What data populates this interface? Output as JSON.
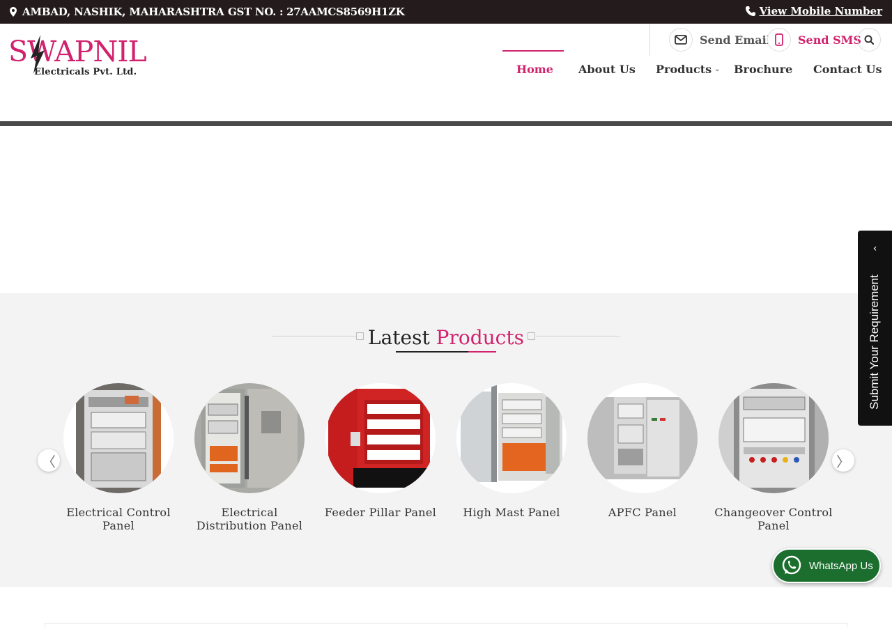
{
  "topbar": {
    "location": "AMBAD, NASHIK, MAHARASHTRA",
    "gst": "GST NO. : 27AAMCS8569H1ZK",
    "mobile_link": "View Mobile Number"
  },
  "logo": {
    "brand": "SWAPNIL",
    "subtitle": "Electricals Pvt. Ltd."
  },
  "header_actions": {
    "send_email": "Send Email",
    "send_sms": "Send SMS"
  },
  "nav": {
    "items": [
      {
        "label": "Home",
        "active": true
      },
      {
        "label": "About Us"
      },
      {
        "label": "Products",
        "has_dropdown": true
      },
      {
        "label": "Brochure"
      },
      {
        "label": "Contact Us"
      }
    ]
  },
  "latest": {
    "title_main": "Latest",
    "title_accent": "Products",
    "products": [
      {
        "name": "Electrical Control Panel"
      },
      {
        "name": "Electrical Distribution Panel"
      },
      {
        "name": "Feeder Pillar Panel"
      },
      {
        "name": "High Mast Panel"
      },
      {
        "name": "APFC Panel"
      },
      {
        "name": "Changeover Control Panel"
      }
    ],
    "prev_icon": "chevron-left-icon",
    "next_icon": "chevron-right-icon"
  },
  "side_tab": {
    "label": "Submit Your Requirement"
  },
  "whatsapp": {
    "label": "WhatsApp Us"
  },
  "colors": {
    "accent": "#d1226d",
    "topbar": "#241c1c",
    "whatsapp": "#1b6e2d"
  }
}
